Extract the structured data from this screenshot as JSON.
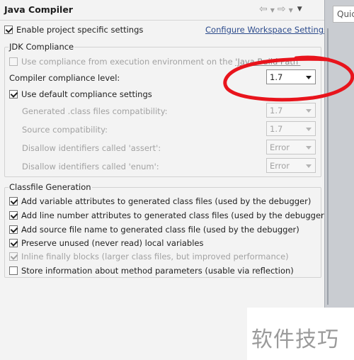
{
  "window": {
    "title": "Java Compiler",
    "quick_access": "Quic"
  },
  "header": {
    "enable_project_specific": {
      "label": "Enable project specific settings",
      "checked": true
    },
    "configure_workspace_link": "Configure Workspace Settings..."
  },
  "jdk_compliance": {
    "title": "JDK Compliance",
    "use_build_path": {
      "label": "Use compliance from execution environment on the ",
      "link": "'Java Build Path'",
      "checked": false,
      "enabled": false
    },
    "compliance_level": {
      "label": "Compiler compliance level:",
      "value": "1.7"
    },
    "use_default": {
      "label": "Use default compliance settings",
      "checked": true
    },
    "settings": [
      {
        "label": "Generated .class files compatibility:",
        "value": "1.7"
      },
      {
        "label": "Source compatibility:",
        "value": "1.7"
      },
      {
        "label": "Disallow identifiers called 'assert':",
        "value": "Error"
      },
      {
        "label": "Disallow identifiers called 'enum':",
        "value": "Error"
      }
    ]
  },
  "classfile_generation": {
    "title": "Classfile Generation",
    "options": [
      {
        "label": "Add variable attributes to generated class files (used by the debugger)",
        "checked": true,
        "enabled": true
      },
      {
        "label": "Add line number attributes to generated class files (used by the debugger)",
        "checked": true,
        "enabled": true
      },
      {
        "label": "Add source file name to generated class file (used by the debugger)",
        "checked": true,
        "enabled": true
      },
      {
        "label": "Preserve unused (never read) local variables",
        "checked": true,
        "enabled": true
      },
      {
        "label": "Inline finally blocks (larger class files, but improved performance)",
        "checked": true,
        "enabled": false
      },
      {
        "label": "Store information about method parameters (usable via reflection)",
        "checked": false,
        "enabled": true
      }
    ]
  },
  "watermark": {
    "text": "软件技巧"
  },
  "colors": {
    "annotation": "#e8141c",
    "link": "#2c4b8c"
  }
}
